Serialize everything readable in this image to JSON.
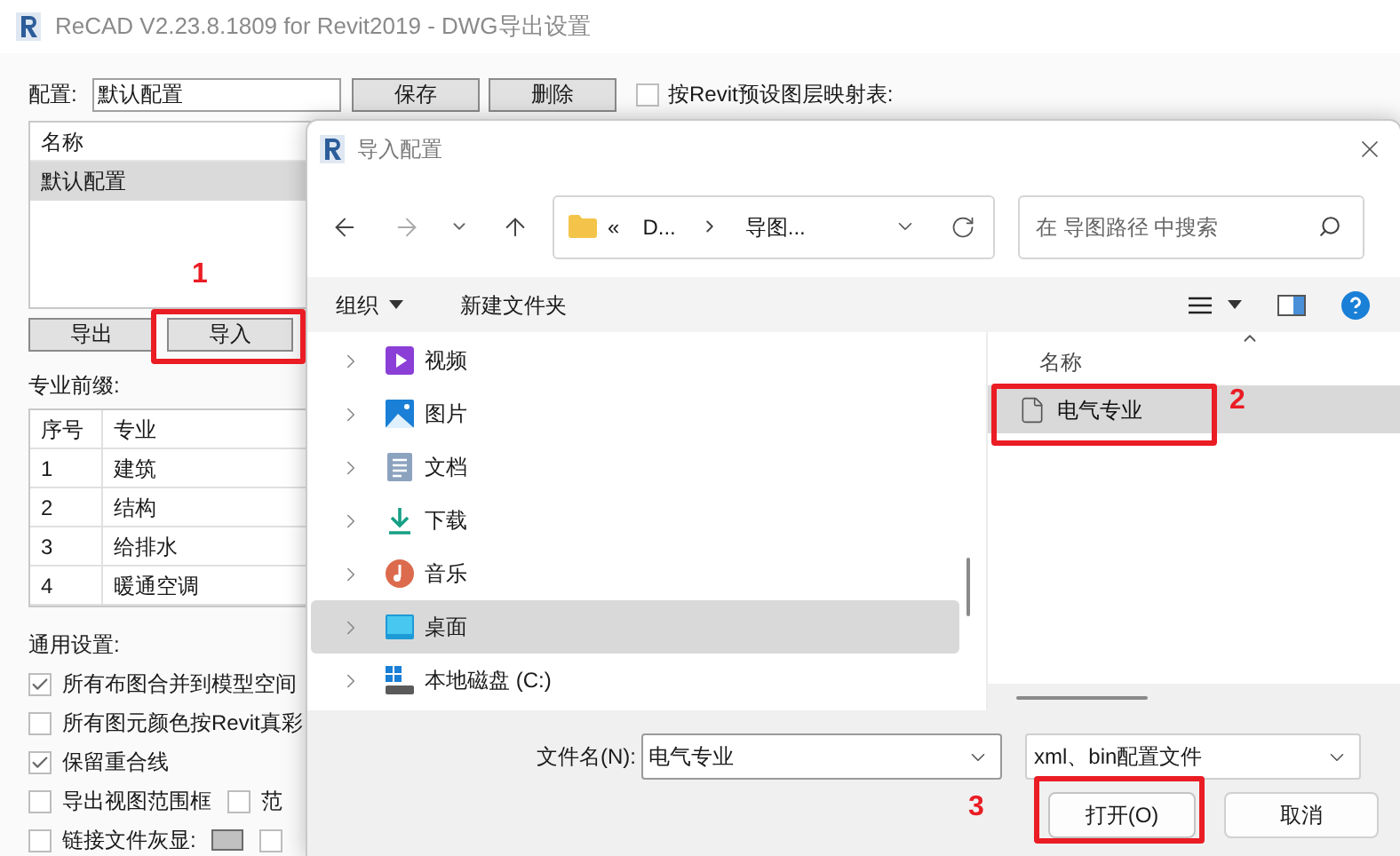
{
  "window": {
    "title": "ReCAD V2.23.8.1809 for Revit2019 - DWG导出设置"
  },
  "config": {
    "label": "配置:",
    "value": "默认配置",
    "buttons": [
      "保存",
      "删除"
    ],
    "layer_map": {
      "label": "按Revit预设图层映射表:",
      "checked": false
    }
  },
  "config_list": {
    "header": "名称",
    "rows": [
      {
        "name": "默认配置",
        "selected": true
      }
    ]
  },
  "list_buttons": [
    "导出",
    "导入"
  ],
  "prefix": {
    "label": "专业前缀:",
    "columns": [
      "序号",
      "专业"
    ],
    "rows": [
      [
        "1",
        "建筑"
      ],
      [
        "2",
        "结构"
      ],
      [
        "3",
        "给排水"
      ],
      [
        "4",
        "暖通空调"
      ]
    ]
  },
  "general": {
    "label": "通用设置:",
    "rows": [
      {
        "items": [
          {
            "kind": "checkbox",
            "label": "所有布图合并到模型空间",
            "checked": true
          }
        ]
      },
      {
        "items": [
          {
            "kind": "checkbox",
            "label": "所有图元颜色按Revit真彩",
            "checked": false
          }
        ]
      },
      {
        "items": [
          {
            "kind": "checkbox",
            "label": "保留重合线",
            "checked": true
          }
        ]
      },
      {
        "items": [
          {
            "kind": "checkbox",
            "label": "导出视图范围框",
            "checked": false
          },
          {
            "kind": "checkbox",
            "label": "范",
            "checked": false
          }
        ]
      },
      {
        "items": [
          {
            "kind": "checkbox",
            "label": "链接文件灰显:",
            "checked": false
          },
          {
            "kind": "swatch",
            "color": "#c0c0c0"
          },
          {
            "kind": "checkbox",
            "checked": false
          }
        ]
      }
    ]
  },
  "dialog": {
    "title": "导入配置",
    "path": {
      "prefix": "«",
      "parts": [
        "D...",
        "导图..."
      ]
    },
    "search": {
      "placeholder": "在 导图路径 中搜索"
    },
    "toolbar": {
      "organize": "组织",
      "new_folder": "新建文件夹"
    },
    "nav": [
      {
        "kind": "video",
        "label": "视频",
        "selected": false
      },
      {
        "kind": "pictures",
        "label": "图片",
        "selected": false
      },
      {
        "kind": "documents",
        "label": "文档",
        "selected": false
      },
      {
        "kind": "downloads",
        "label": "下载",
        "selected": false
      },
      {
        "kind": "music",
        "label": "音乐",
        "selected": false
      },
      {
        "kind": "desktop",
        "label": "桌面",
        "selected": true
      },
      {
        "kind": "disk",
        "label": "本地磁盘 (C:)",
        "selected": false
      }
    ],
    "files": {
      "header": "名称",
      "rows": [
        {
          "name": "电气专业",
          "selected": true
        }
      ]
    },
    "filename": {
      "label": "文件名(N):",
      "value": "电气专业"
    },
    "filetype": {
      "value": "xml、bin配置文件"
    },
    "buttons": [
      {
        "label": "打开(O)",
        "kind": "primary"
      },
      {
        "label": "取消",
        "kind": "secondary"
      }
    ]
  },
  "annotations": [
    "1",
    "2",
    "3"
  ]
}
